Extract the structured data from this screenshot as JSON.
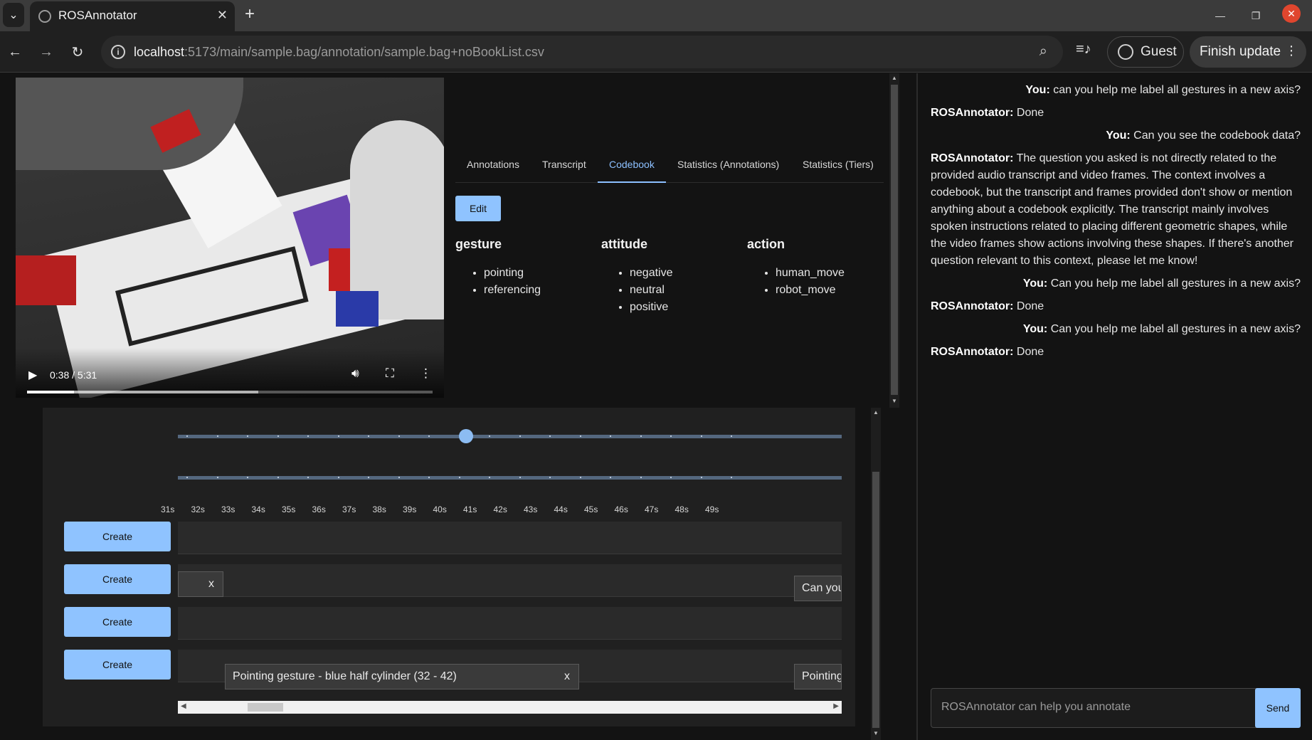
{
  "browser": {
    "tab_title": "ROSAnnotator",
    "url_host": "localhost",
    "url_rest": ":5173/main/sample.bag/annotation/sample.bag+noBookList.csv",
    "profile_label": "Guest",
    "finish_update_label": "Finish update"
  },
  "video": {
    "time_display": "0:38 / 5:31",
    "progress_fraction": 0.115,
    "buffered_fraction": 0.57
  },
  "tabs": [
    {
      "label": "Annotations"
    },
    {
      "label": "Transcript"
    },
    {
      "label": "Codebook"
    },
    {
      "label": "Statistics (Annotations)"
    },
    {
      "label": "Statistics (Tiers)"
    }
  ],
  "active_tab": "Codebook",
  "codebook": {
    "edit_label": "Edit",
    "categories": [
      {
        "name": "gesture",
        "items": [
          "pointing",
          "referencing"
        ]
      },
      {
        "name": "attitude",
        "items": [
          "negative",
          "neutral",
          "positive"
        ]
      },
      {
        "name": "action",
        "items": [
          "human_move",
          "robot_move"
        ]
      }
    ]
  },
  "timeline": {
    "ticks": [
      "31s",
      "32s",
      "33s",
      "34s",
      "35s",
      "36s",
      "37s",
      "38s",
      "39s",
      "40s",
      "41s",
      "42s",
      "43s",
      "44s",
      "45s",
      "46s",
      "47s",
      "48s",
      "49s"
    ],
    "current_fraction": 0.434,
    "create_label": "Create",
    "close_glyph": "x",
    "segments": {
      "tier2_right": "Can you",
      "tier4_main": "Pointing gesture - blue half cylinder (32 - 42)",
      "tier4_right": "Pointing"
    }
  },
  "chat": {
    "messages": [
      {
        "sender": "You:",
        "text": "can you help me label all gestures in a new axis?"
      },
      {
        "sender": "ROSAnnotator:",
        "text": "Done"
      },
      {
        "sender": "You:",
        "text": "Can you see the codebook data?"
      },
      {
        "sender": "ROSAnnotator:",
        "text": "The question you asked is not directly related to the provided audio transcript and video frames. The context involves a codebook, but the transcript and frames provided don't show or mention anything about a codebook explicitly. The transcript mainly involves spoken instructions related to placing different geometric shapes, while the video frames show actions involving these shapes. If there's another question relevant to this context, please let me know!"
      },
      {
        "sender": "You:",
        "text": "Can you help me label all gestures in a new axis?"
      },
      {
        "sender": "ROSAnnotator:",
        "text": "Done"
      },
      {
        "sender": "You:",
        "text": "Can you help me label all gestures in a new axis?"
      },
      {
        "sender": "ROSAnnotator:",
        "text": "Done"
      }
    ],
    "input_placeholder": "ROSAnnotator can help you annotate",
    "send_label": "Send"
  },
  "colors": {
    "accent": "#8fc3ff",
    "active_tab": "#8cc0ff",
    "background": "#131313",
    "panel": "#202020"
  },
  "icons": [
    "tab-search-icon",
    "app-favicon-icon",
    "close-icon",
    "new-tab-icon",
    "minimize-icon",
    "restore-icon",
    "window-close-icon",
    "back-icon",
    "forward-icon",
    "reload-icon",
    "info-icon",
    "zoom-icon",
    "media-control-icon",
    "profile-icon",
    "more-icon",
    "play-icon",
    "volume-icon",
    "fullscreen-icon",
    "video-more-icon"
  ]
}
